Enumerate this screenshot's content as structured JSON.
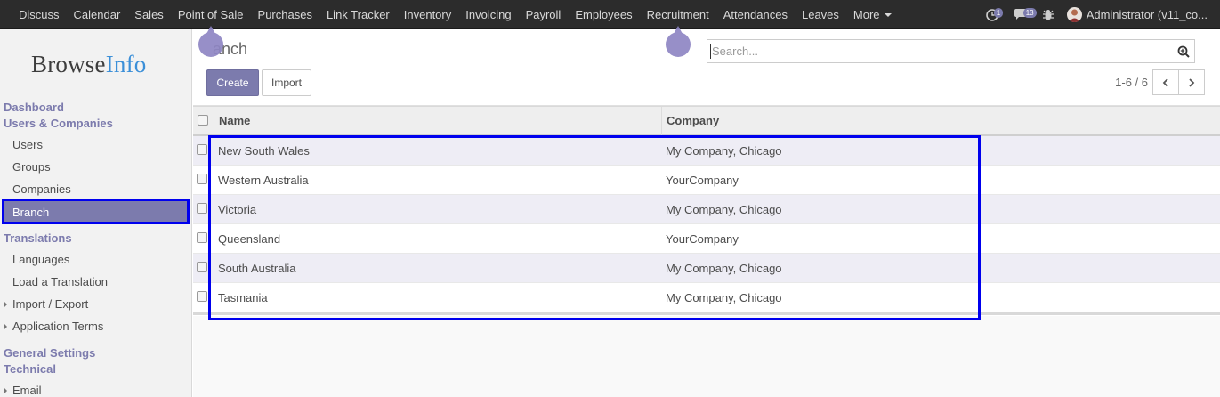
{
  "topbar": {
    "menu": [
      "Discuss",
      "Calendar",
      "Sales",
      "Point of Sale",
      "Purchases",
      "Link Tracker",
      "Inventory",
      "Invoicing",
      "Payroll",
      "Employees",
      "Recruitment",
      "Attendances",
      "Leaves"
    ],
    "more_label": "More",
    "activity_badge": "1",
    "messages_badge": "13",
    "user_label": "Administrator (v11_co..."
  },
  "sidebar": {
    "logo_part1": "Browse",
    "logo_part2": "Info",
    "sections": {
      "dashboard": "Dashboard",
      "users_companies": "Users & Companies",
      "translations": "Translations",
      "general_settings": "General Settings",
      "technical": "Technical"
    },
    "items": {
      "users": "Users",
      "groups": "Groups",
      "companies": "Companies",
      "branch": "Branch",
      "languages": "Languages",
      "load_translation": "Load a Translation",
      "import_export": "Import / Export",
      "application_terms": "Application Terms",
      "email": "Email"
    }
  },
  "control": {
    "breadcrumb": "anch",
    "create_label": "Create",
    "import_label": "Import",
    "search_placeholder": "Search...",
    "pager": "1-6 / 6"
  },
  "list": {
    "columns": [
      "Name",
      "Company"
    ],
    "rows": [
      {
        "name": "New South Wales",
        "company": "My Company, Chicago"
      },
      {
        "name": "Western Australia",
        "company": "YourCompany"
      },
      {
        "name": "Victoria",
        "company": "My Company, Chicago"
      },
      {
        "name": "Queensland",
        "company": "YourCompany"
      },
      {
        "name": "South Australia",
        "company": "My Company, Chicago"
      },
      {
        "name": "Tasmania",
        "company": "My Company, Chicago"
      }
    ]
  },
  "colors": {
    "brand": "#7c7bad",
    "navbar": "#2c2c2c",
    "annotation": "#0000ee"
  }
}
